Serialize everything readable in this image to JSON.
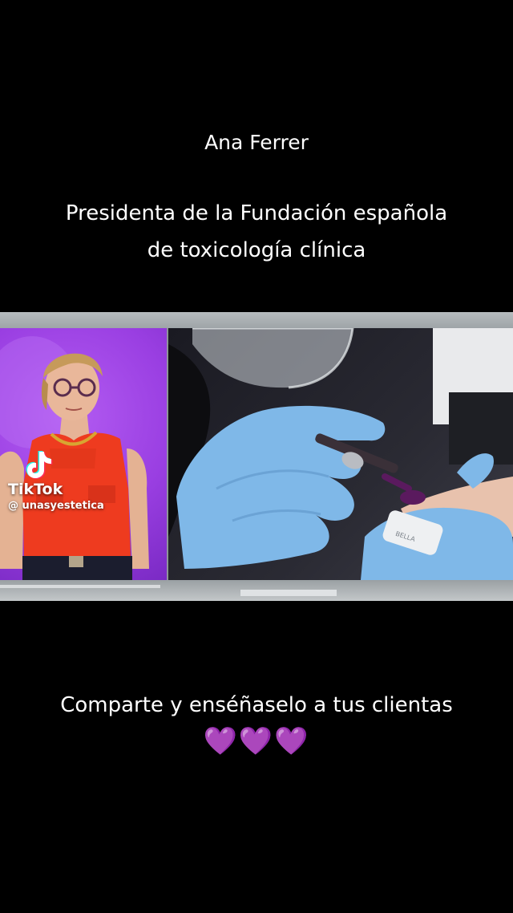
{
  "captions": {
    "name": "Ana Ferrer",
    "role_line1": "Presidenta de la Fundación española",
    "role_line2": "de toxicología clínica",
    "share_text": "Comparte y enséñaselo a tus clientas",
    "hearts": "💜💜💜"
  },
  "watermark": {
    "brand": "TikTok",
    "handle": "@ unasyestetica"
  },
  "colors": {
    "background": "#000000",
    "left_panel_purple": "#9a3fe2",
    "glove_blue": "#7fb8e8",
    "top_red": "#ee3b1f",
    "nail_purple": "#5a1a5e"
  }
}
